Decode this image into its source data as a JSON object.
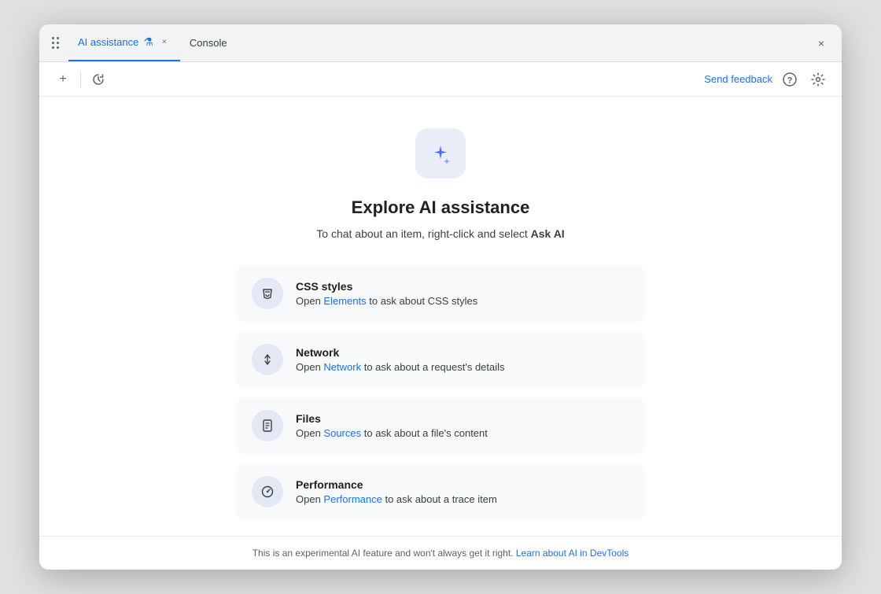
{
  "window": {
    "title": "AI assistance"
  },
  "titlebar": {
    "tab_ai_label": "AI assistance",
    "tab_ai_beaker": "⚗",
    "tab_close_symbol": "×",
    "tab_console_label": "Console",
    "window_close_symbol": "×",
    "dots": "⋮"
  },
  "toolbar": {
    "new_tab_symbol": "+",
    "history_symbol": "↺",
    "send_feedback_label": "Send feedback",
    "help_symbol": "?",
    "settings_symbol": "⚙"
  },
  "main": {
    "icon_symbol": "✦",
    "title": "Explore AI assistance",
    "subtitle_text": "To chat about an item, right-click and select ",
    "subtitle_bold": "Ask AI",
    "features": [
      {
        "id": "css",
        "icon": "✏",
        "title": "CSS styles",
        "desc_before": "Open ",
        "link_text": "Elements",
        "desc_after": " to ask about CSS styles"
      },
      {
        "id": "network",
        "icon": "⇅",
        "title": "Network",
        "desc_before": "Open ",
        "link_text": "Network",
        "desc_after": " to ask about a request's details"
      },
      {
        "id": "files",
        "icon": "□",
        "title": "Files",
        "desc_before": "Open ",
        "link_text": "Sources",
        "desc_after": " to ask about a file's content"
      },
      {
        "id": "performance",
        "icon": "◷",
        "title": "Performance",
        "desc_before": "Open ",
        "link_text": "Performance",
        "desc_after": " to ask about a trace item"
      }
    ]
  },
  "footer": {
    "text": "This is an experimental AI feature and won't always get it right. ",
    "link_text": "Learn about AI in DevTools"
  }
}
